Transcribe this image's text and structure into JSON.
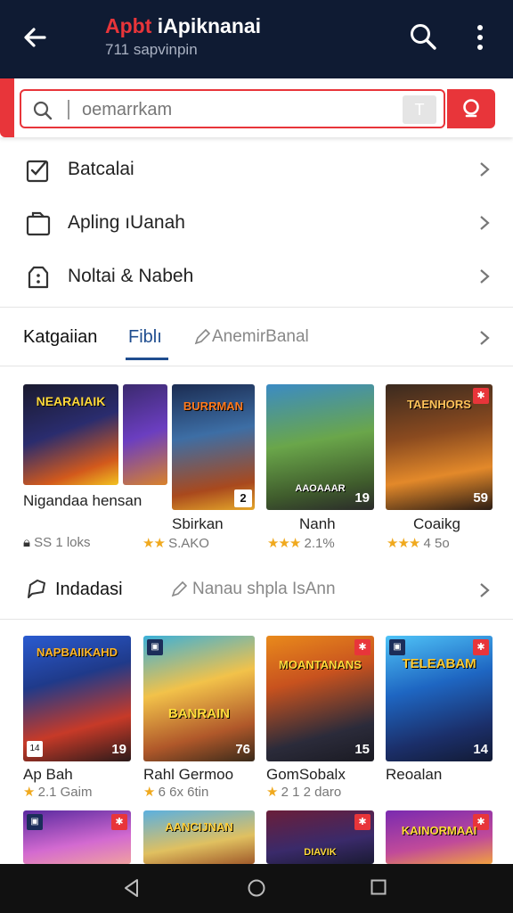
{
  "header": {
    "title_accent": "Apbt",
    "title_rest": " iApiknanai",
    "subtitle": "711 sapvinpin"
  },
  "search": {
    "placeholder": "oemarrkam",
    "clear_label": "T"
  },
  "menu": {
    "items": [
      {
        "label": "Batcalai",
        "icon": "checklist-icon"
      },
      {
        "label": "Apling ıUanah",
        "icon": "clipboard-icon"
      },
      {
        "label": "Noltai & Nabeh",
        "icon": "package-icon"
      }
    ]
  },
  "tabs": {
    "section_label": "Katgaiian",
    "active": "Fiblı",
    "other": "AnemirBanal"
  },
  "row1": [
    {
      "title": "Nigandaa hensan",
      "rating": "SS 1 loks",
      "badge": "",
      "poster": "NEARAIAIK",
      "stars": "",
      "prefix": "❡"
    },
    {
      "title": "Sbirkan",
      "rating": "S.AKO",
      "badge": "2",
      "poster": "BURRMAN",
      "stars": "★★",
      "prefix": ""
    },
    {
      "title": "Nanh",
      "rating": "2.1%",
      "badge": "19",
      "poster": "AAOAAAR",
      "stars": "★★★",
      "prefix": ""
    },
    {
      "title": "Coaikg",
      "rating": "4 5o",
      "badge": "59",
      "poster": "TAENHORS",
      "stars": "★★★",
      "prefix": ""
    }
  ],
  "section2": {
    "label": "Indadasi",
    "link": "Nanau shpla IsAnn"
  },
  "row2": [
    {
      "title": "Ap Bah",
      "rating": "2.1 Gaim",
      "badge": "19",
      "poster": "NAPBAIIKAHD",
      "stars": "★",
      "corner": "blue"
    },
    {
      "title": "Rahl Germoo",
      "rating": "6 6x 6tin",
      "badge": "76",
      "poster": "BANRAIN",
      "stars": "★",
      "corner": "blue"
    },
    {
      "title": "GomSobalx",
      "rating": "2 1 2 daro",
      "badge": "15",
      "poster": "MOANTANANS",
      "stars": "★",
      "corner": "red"
    },
    {
      "title": "Reoalan",
      "rating": "",
      "badge": "14",
      "poster": "TELEABAM",
      "stars": "",
      "corner": "blue"
    }
  ],
  "row3_posters": [
    "",
    "AANCIJNAN",
    "DIAVIK",
    "KAINORMAAI"
  ],
  "colors": {
    "header_bg": "#0f1b33",
    "accent": "#e8353a",
    "tab_active": "#1f4d8f",
    "star": "#f0a91e"
  }
}
